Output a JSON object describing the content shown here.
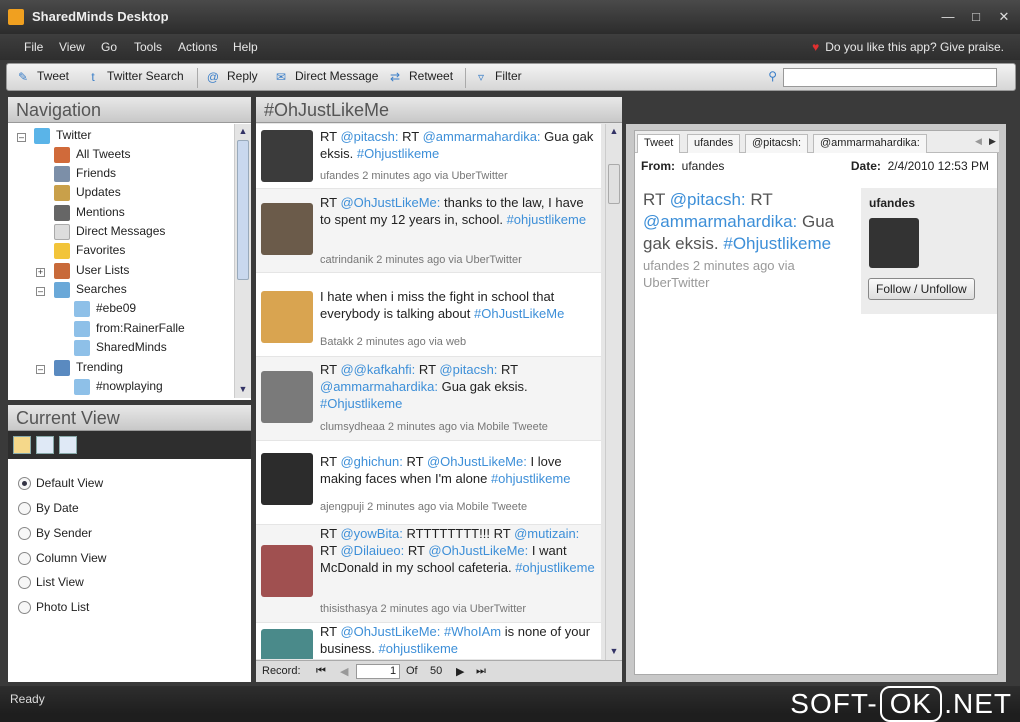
{
  "app": {
    "title": "SharedMinds Desktop"
  },
  "menu": [
    "File",
    "View",
    "Go",
    "Tools",
    "Actions",
    "Help"
  ],
  "promo": "Do you like this app? Give praise.",
  "toolbar": {
    "tweet": "Tweet",
    "twitter_search": "Twitter Search",
    "reply": "Reply",
    "direct_message": "Direct Message",
    "retweet": "Retweet",
    "filter": "Filter",
    "search_value": ""
  },
  "navigation": {
    "header": "Navigation",
    "items": [
      {
        "label": "Twitter",
        "icon": "twitter-bird-icon"
      },
      {
        "label": "All Tweets",
        "icon": "home-icon"
      },
      {
        "label": "Friends",
        "icon": "person-icon"
      },
      {
        "label": "Updates",
        "icon": "pencil-icon"
      },
      {
        "label": "Mentions",
        "icon": "at-icon"
      },
      {
        "label": "Direct Messages",
        "icon": "envelope-icon"
      },
      {
        "label": "Favorites",
        "icon": "star-icon"
      },
      {
        "label": "User Lists",
        "icon": "people-icon"
      },
      {
        "label": "Searches",
        "icon": "search-folder-icon"
      },
      {
        "label": "#ebe09",
        "icon": "search-icon"
      },
      {
        "label": "from:RainerFalle",
        "icon": "search-icon"
      },
      {
        "label": "SharedMinds",
        "icon": "search-icon"
      },
      {
        "label": "Trending",
        "icon": "trending-icon"
      },
      {
        "label": "#nowplaying",
        "icon": "search-icon"
      }
    ]
  },
  "current_view": {
    "header": "Current View",
    "options": [
      "Default View",
      "By Date",
      "By Sender",
      "Column View",
      "List View",
      "Photo List"
    ],
    "selected": "Default View"
  },
  "timeline": {
    "header": "#OhJustLikeMe",
    "tweets": [
      {
        "text": "RT @pitacsh: RT @ammarmahardika: Gua gak eksis. #Ohjustlikeme",
        "meta": "ufandes 2 minutes  ago via UberTwitter"
      },
      {
        "text": "RT @OhJustLikeMe: thanks to the law, I have to spent my 12 years in, school. #ohjustlikeme",
        "meta": "catrindanik 2 minutes  ago via UberTwitter"
      },
      {
        "text": "I hate when i miss the fight in school that everybody is talking about #OhJustLikeMe",
        "meta": "Batakk 2 minutes  ago via web"
      },
      {
        "text": "RT @@kafkahfi: RT @pitacsh: RT @ammarmahardika: Gua gak eksis. #Ohjustlikeme",
        "meta": "clumsydheaa  2 minutes  ago via Mobile Tweete"
      },
      {
        "text": "RT @ghichun: RT @OhJustLikeMe: I love making faces when I'm alone #ohjustlikeme",
        "meta": "ajengpuji  2 minutes  ago via Mobile Tweete"
      },
      {
        "text": "RT @yowBita: RTTTTTTTT!!! RT @mutizain: RT @Dilaiueo: RT @OhJustLikeMe: I want McDonald in my school cafeteria. #ohjustlikeme",
        "meta": "thisisthasya  2 minutes  ago via UberTwitter"
      },
      {
        "text": "RT @OhJustLikeMe: #WhoIAm is none of your business. #ohjustlikeme",
        "meta": ""
      }
    ],
    "pager": {
      "record": "Record:",
      "page": "1",
      "of": "Of",
      "total": "50"
    }
  },
  "detail": {
    "tabs": [
      "Tweet",
      "ufandes",
      "@pitacsh:",
      "@ammarmahardika:"
    ],
    "from_label": "From:",
    "from_value": "ufandes",
    "date_label": "Date:",
    "date_value": "2/4/2010 12:53 PM",
    "text": "RT @pitacsh: RT @ammarmahardika: Gua gak eksis. #Ohjustlikeme",
    "meta": "ufandes 2 minutes ago via UberTwitter",
    "username": "ufandes",
    "follow_button": "Follow / Unfollow"
  },
  "status": "Ready",
  "watermark": {
    "left": "SOFT-",
    "mid": "OK",
    "right": ".NET"
  }
}
